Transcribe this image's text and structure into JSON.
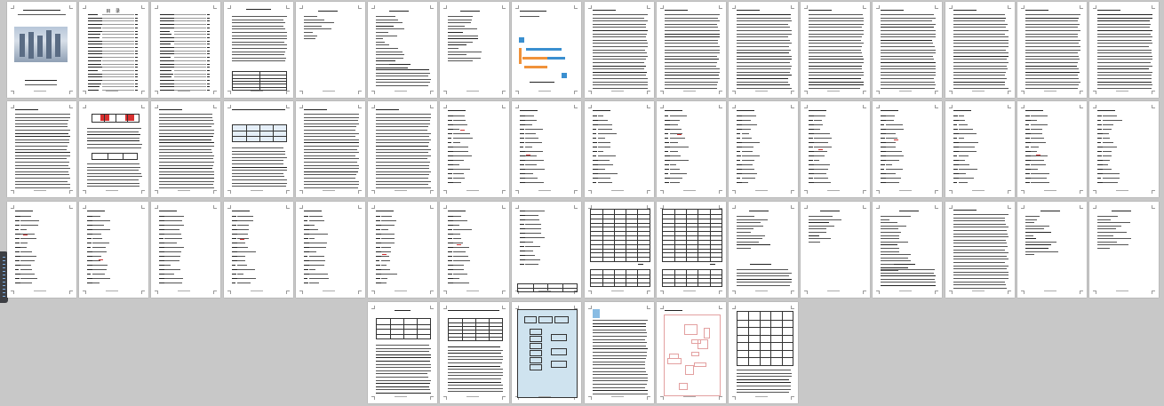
{
  "viewer": {
    "background_color": "#c8c8c8",
    "page_color": "#ffffff"
  },
  "pages": {
    "toc_title": "目 录"
  },
  "colors": {
    "diagram_fill": "#cfe3ef",
    "accent_red": "#d83030",
    "accent_orange": "#f0923a",
    "accent_blue": "#3a8fd0"
  }
}
